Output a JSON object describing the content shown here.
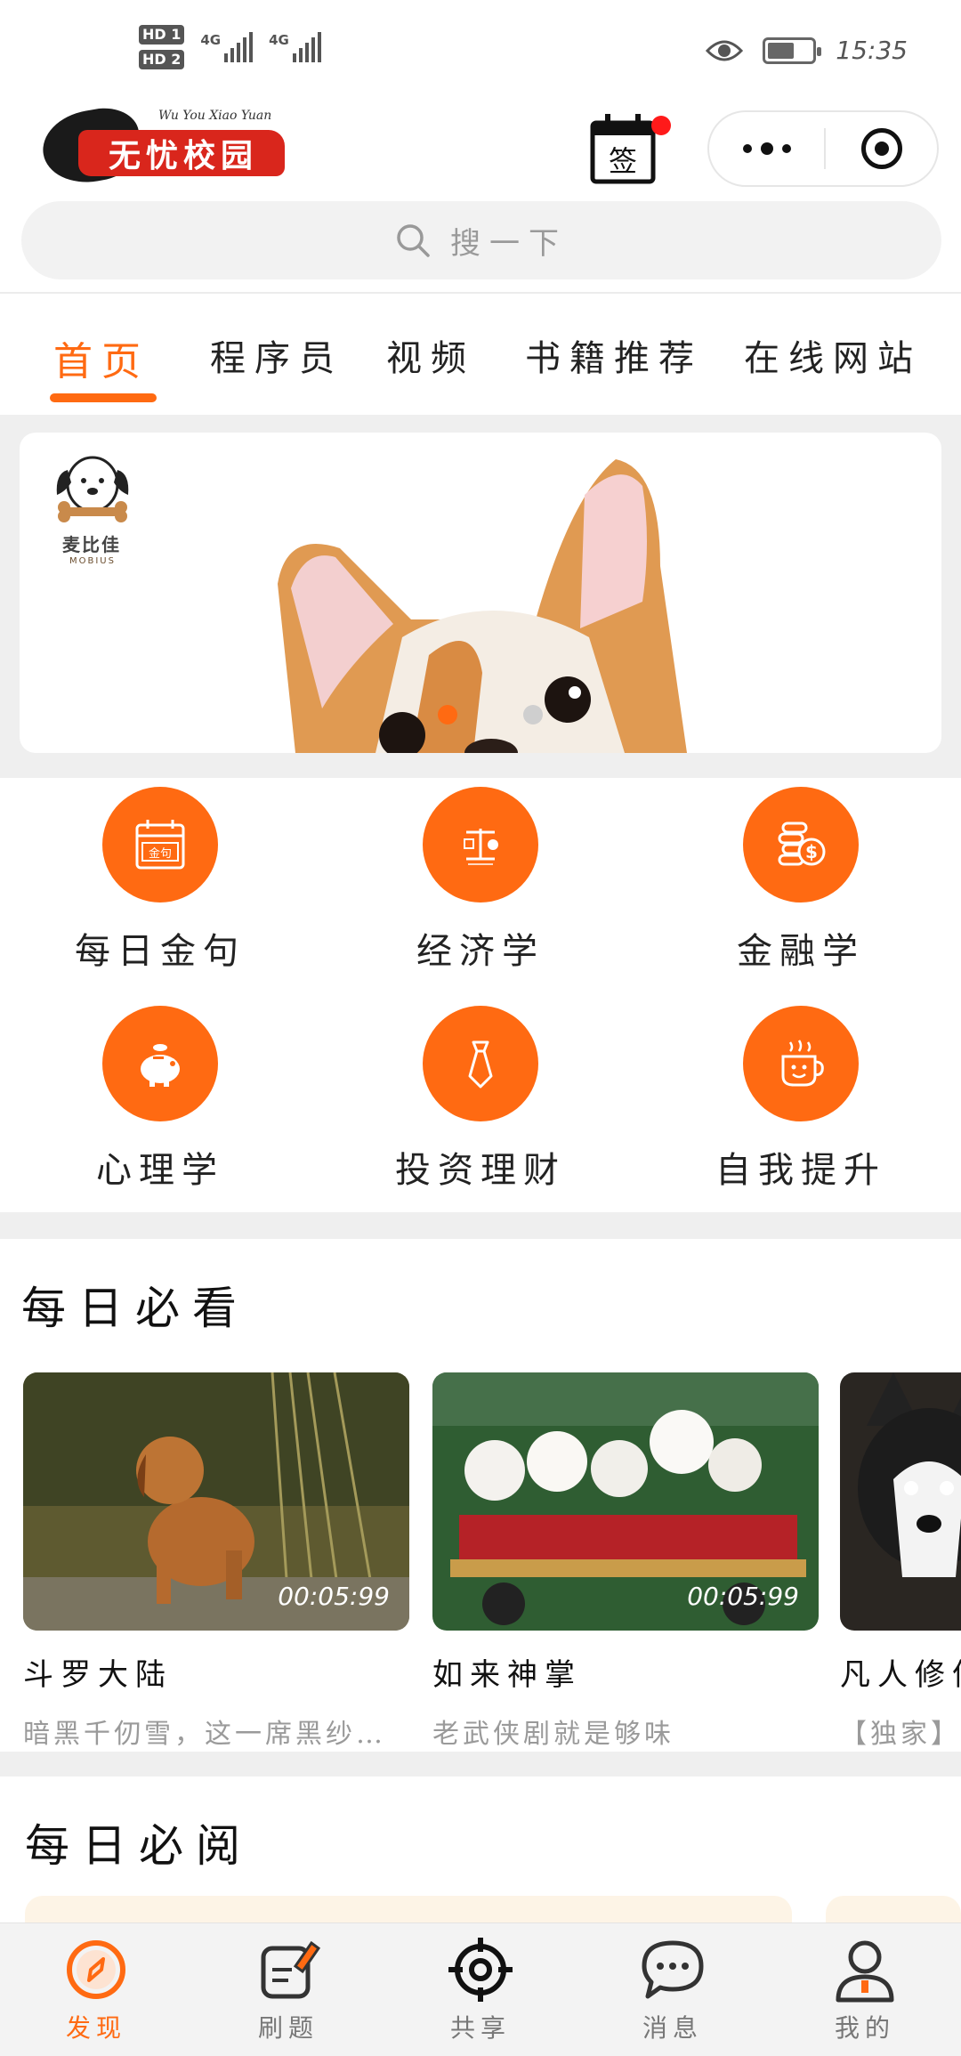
{
  "status_bar": {
    "hd1": "HD 1",
    "hd2": "HD 2",
    "net1": "4G",
    "net2": "4G",
    "time": "15:35",
    "battery_level": 0.6
  },
  "header": {
    "logo_text": [
      "无",
      "忧",
      "校",
      "园"
    ],
    "logo_subtext": "Wu You Xiao Yuan",
    "signin_glyph": "签"
  },
  "search": {
    "placeholder": "搜一下"
  },
  "tabs": [
    {
      "label": "首页",
      "active": true
    },
    {
      "label": "程序员",
      "active": false
    },
    {
      "label": "视频",
      "active": false
    },
    {
      "label": "书籍推荐",
      "active": false
    },
    {
      "label": "在线网站",
      "active": false
    }
  ],
  "banner": {
    "brand_name": "麦比佳",
    "brand_en": "MOBIUS",
    "slide_count": 2,
    "active_slide": 1
  },
  "categories": [
    {
      "label": "每日金句",
      "icon": "calendar-quote-icon",
      "icon_text": "金句"
    },
    {
      "label": "经济学",
      "icon": "economics-icon"
    },
    {
      "label": "金融学",
      "icon": "coins-dollar-icon"
    },
    {
      "label": "心理学",
      "icon": "piggy-bank-icon"
    },
    {
      "label": "投资理财",
      "icon": "tie-icon"
    },
    {
      "label": "自我提升",
      "icon": "smile-cup-icon"
    }
  ],
  "daily_watch": {
    "title": "每日必看",
    "videos": [
      {
        "title": "斗罗大陆",
        "desc": "暗黑千仞雪，这一席黑纱…",
        "duration": "00:05:99"
      },
      {
        "title": "如来神掌",
        "desc": "老武侠剧就是够味",
        "duration": "00:05:99"
      },
      {
        "title": "凡人修仙",
        "desc": "【独家】",
        "duration": ""
      }
    ]
  },
  "daily_read": {
    "title": "每日必阅"
  },
  "bottom_nav": [
    {
      "label": "发现",
      "icon": "compass-icon",
      "active": true
    },
    {
      "label": "刷题",
      "icon": "note-pen-icon",
      "active": false
    },
    {
      "label": "共享",
      "icon": "crosshair-icon",
      "active": false
    },
    {
      "label": "消息",
      "icon": "chat-bubble-icon",
      "active": false
    },
    {
      "label": "我的",
      "icon": "user-icon",
      "active": false
    }
  ],
  "colors": {
    "accent": "#ff6a12",
    "logo_red": "#d9261c",
    "notify_red": "#ff1a1a",
    "gray_band": "#efefef"
  }
}
